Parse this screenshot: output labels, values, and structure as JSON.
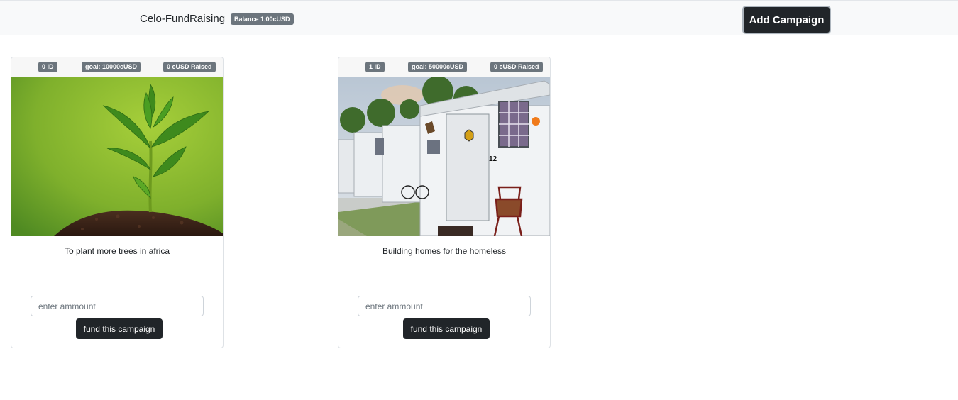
{
  "navbar": {
    "brand": "Celo-FundRaising",
    "balance_badge": "Balance 1.00cUSD",
    "add_campaign_label": "Add Campaign"
  },
  "campaigns": [
    {
      "id_badge": "0 ID",
      "goal_badge": "goal: 10000cUSD",
      "raised_badge": "0 cUSD Raised",
      "description": "To plant more trees in africa",
      "image_alt": "sapling growing from soil",
      "amount_placeholder": "enter ammount",
      "fund_label": "fund this campaign"
    },
    {
      "id_badge": "1 ID",
      "goal_badge": "goal: 50000cUSD",
      "raised_badge": "0 cUSD Raised",
      "description": "Building homes for the homeless",
      "image_alt": "row of small white shelter homes",
      "amount_placeholder": "enter ammount",
      "fund_label": "fund this campaign"
    }
  ],
  "colors": {
    "navbar_bg": "#f8f9fa",
    "dark_button": "#212529",
    "badge_bg": "#6c757d"
  }
}
